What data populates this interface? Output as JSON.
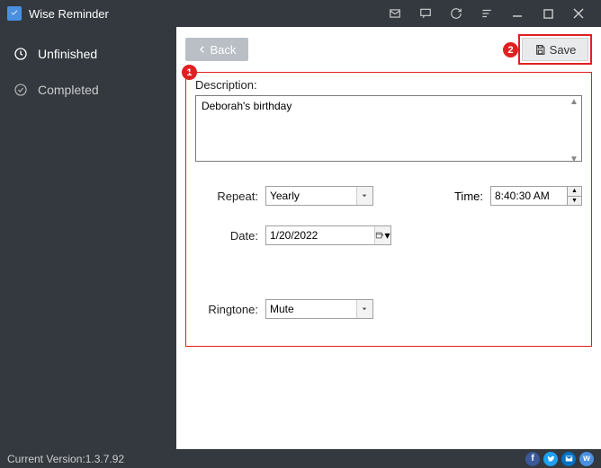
{
  "app": {
    "title": "Wise Reminder"
  },
  "sidebar": {
    "items": [
      {
        "label": "Unfinished"
      },
      {
        "label": "Completed"
      }
    ]
  },
  "toolbar": {
    "back": "Back",
    "save": "Save"
  },
  "annotations": {
    "back_num": "1",
    "save_num": "2"
  },
  "form": {
    "description_label": "Description:",
    "description_value": "Deborah's birthday",
    "repeat_label": "Repeat:",
    "repeat_value": "Yearly",
    "time_label": "Time:",
    "time_value": "8:40:30 AM",
    "date_label": "Date:",
    "date_value": "1/20/2022",
    "ringtone_label": "Ringtone:",
    "ringtone_value": "Mute"
  },
  "status": {
    "version_label": "Current Version:",
    "version_value": "1.3.7.92"
  }
}
